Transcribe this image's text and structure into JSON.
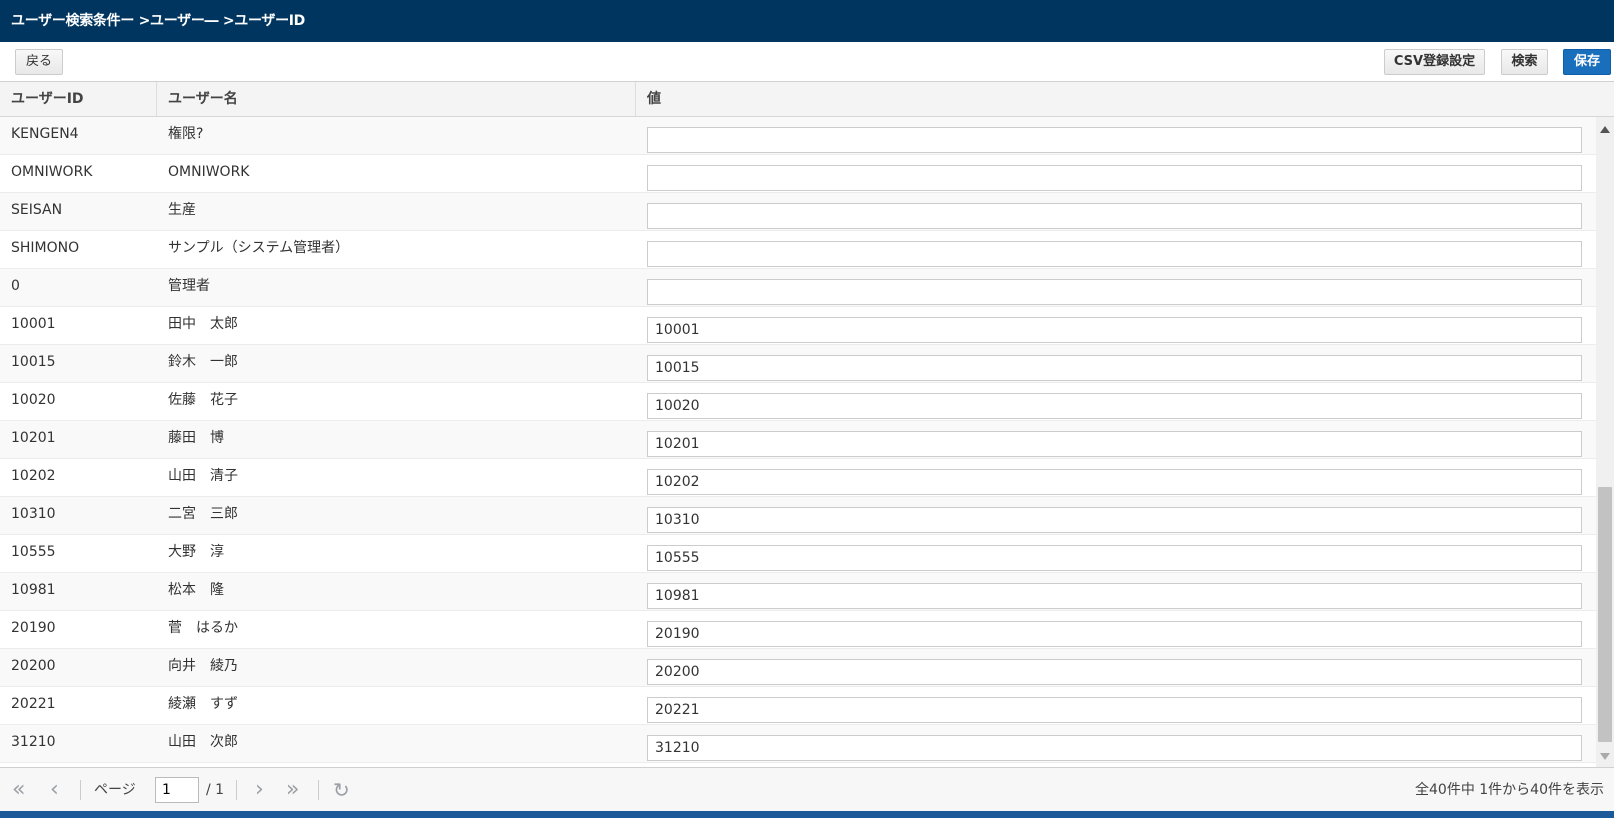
{
  "title": "ユーザー検索条件ー >ユーザー― >ユーザーID",
  "toolbar": {
    "back_label": "戻る",
    "csv_label": "CSV登録設定",
    "search_label": "検索",
    "save_label": "保存"
  },
  "columns": [
    "ユーザーID",
    "ユーザー名",
    "値"
  ],
  "rows": [
    {
      "id": "KENGEN4",
      "name": "権限?",
      "value": ""
    },
    {
      "id": "OMNIWORK",
      "name": "OMNIWORK",
      "value": ""
    },
    {
      "id": "SEISAN",
      "name": "生産",
      "value": ""
    },
    {
      "id": "SHIMONO",
      "name": "サンプル（システム管理者）",
      "value": ""
    },
    {
      "id": "0",
      "name": "管理者",
      "value": ""
    },
    {
      "id": "10001",
      "name": "田中　太郎",
      "value": "10001"
    },
    {
      "id": "10015",
      "name": "鈴木　一郎",
      "value": "10015"
    },
    {
      "id": "10020",
      "name": "佐藤　花子",
      "value": "10020"
    },
    {
      "id": "10201",
      "name": "藤田　博",
      "value": "10201"
    },
    {
      "id": "10202",
      "name": "山田　清子",
      "value": "10202"
    },
    {
      "id": "10310",
      "name": "二宮　三郎",
      "value": "10310"
    },
    {
      "id": "10555",
      "name": "大野　淳",
      "value": "10555"
    },
    {
      "id": "10981",
      "name": "松本　隆",
      "value": "10981"
    },
    {
      "id": "20190",
      "name": "菅　はるか",
      "value": "20190"
    },
    {
      "id": "20200",
      "name": "向井　綾乃",
      "value": "20200"
    },
    {
      "id": "20221",
      "name": "綾瀬　すず",
      "value": "20221"
    },
    {
      "id": "31210",
      "name": "山田　次郎",
      "value": "31210"
    }
  ],
  "pager": {
    "page_label": "ページ",
    "current_page": "1",
    "total_pages": "/ 1",
    "summary": "全40件中 1件から40件を表示",
    "first_icon": "first-page-icon",
    "prev_icon": "prev-page-icon",
    "next_icon": "next-page-icon",
    "last_icon": "last-page-icon",
    "refresh_icon": "refresh-icon"
  },
  "colors": {
    "titlebar": "#003560",
    "save_button": "#1a6fbd",
    "bottom_bar": "#1c5a9a"
  }
}
